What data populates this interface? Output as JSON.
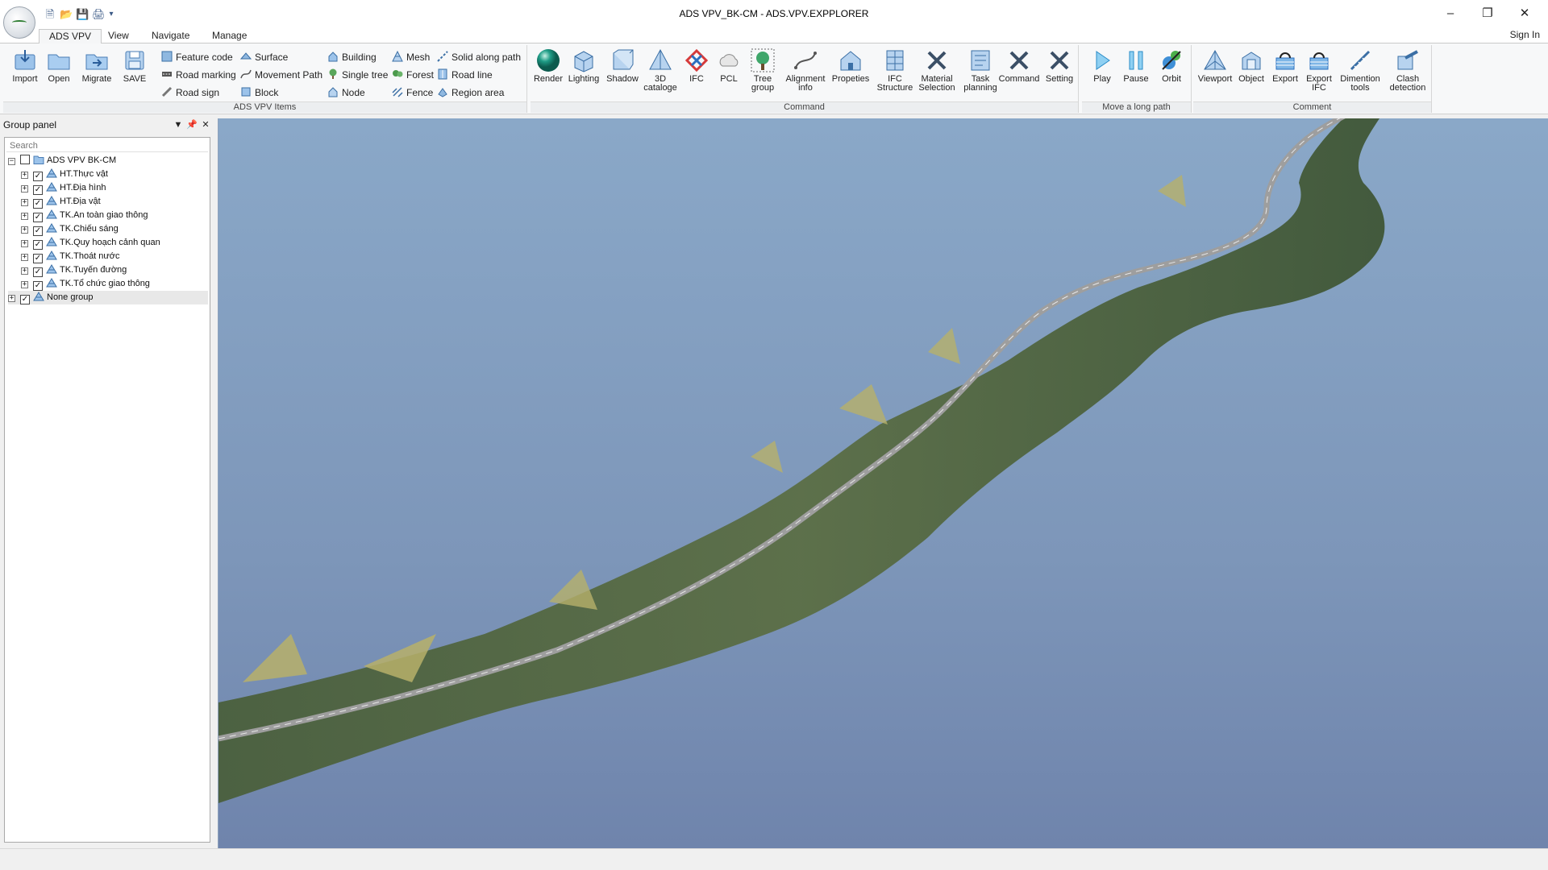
{
  "window": {
    "title": "ADS VPV_BK-CM - ADS.VPV.EXPPLORER",
    "minimize": "–",
    "restore": "❐",
    "close": "✕"
  },
  "quick_access": {
    "dropdown": "▾"
  },
  "tabs": [
    {
      "label": "ADS VPV"
    },
    {
      "label": "View"
    },
    {
      "label": "Navigate"
    },
    {
      "label": "Manage"
    }
  ],
  "sign_in": "Sign In",
  "ribbon": {
    "file_buttons": [
      {
        "label": "Import",
        "icon": "import-icon"
      },
      {
        "label": "Open",
        "icon": "folder-icon"
      },
      {
        "label": "Migrate",
        "icon": "migrate-icon"
      },
      {
        "label": "SAVE",
        "icon": "save-icon"
      }
    ],
    "ads_items": {
      "label": "ADS VPV Items",
      "items": [
        {
          "label": "Feature code",
          "icon": "feature-code-icon"
        },
        {
          "label": "Road marking",
          "icon": "road-marking-icon"
        },
        {
          "label": "Road sign",
          "icon": "road-sign-icon"
        },
        {
          "label": "Surface",
          "icon": "surface-icon"
        },
        {
          "label": "Movement Path",
          "icon": "movement-path-icon"
        },
        {
          "label": "Block",
          "icon": "block-icon"
        },
        {
          "label": "Building",
          "icon": "building-icon"
        },
        {
          "label": "Single tree",
          "icon": "single-tree-icon"
        },
        {
          "label": "Node",
          "icon": "node-icon"
        },
        {
          "label": "Mesh",
          "icon": "mesh-icon"
        },
        {
          "label": "Forest",
          "icon": "forest-icon"
        },
        {
          "label": "Fence",
          "icon": "fence-icon"
        },
        {
          "label": "Solid along path",
          "icon": "solid-along-path-icon"
        },
        {
          "label": "Road line",
          "icon": "road-line-icon"
        },
        {
          "label": "Region area",
          "icon": "region-area-icon"
        }
      ]
    },
    "command": {
      "label": "Command",
      "buttons": [
        {
          "line1": "Render",
          "line2": "",
          "icon": "render-sphere-icon"
        },
        {
          "line1": "Lighting",
          "line2": "",
          "icon": "lighting-icon"
        },
        {
          "line1": "Shadow",
          "line2": "",
          "icon": "shadow-icon"
        },
        {
          "line1": "3D",
          "line2": "cataloge",
          "icon": "catalogue-icon"
        },
        {
          "line1": "IFC",
          "line2": "",
          "icon": "ifc-icon"
        },
        {
          "line1": "PCL",
          "line2": "",
          "icon": "point-cloud-icon"
        },
        {
          "line1": "Tree",
          "line2": "group",
          "icon": "tree-group-icon"
        },
        {
          "line1": "Alignment",
          "line2": "info",
          "icon": "alignment-icon"
        },
        {
          "line1": "Propeties",
          "line2": "",
          "icon": "properties-house-icon"
        },
        {
          "line1": "IFC",
          "line2": "Structure",
          "icon": "ifc-structure-icon"
        },
        {
          "line1": "Material",
          "line2": "Selection",
          "icon": "material-tools-icon"
        },
        {
          "line1": "Task",
          "line2": "planning",
          "icon": "task-planning-icon"
        },
        {
          "line1": "Command",
          "line2": "",
          "icon": "command-tools-icon"
        },
        {
          "line1": "Setting",
          "line2": "",
          "icon": "setting-tools-icon"
        }
      ]
    },
    "move": {
      "label": "Move a long path",
      "buttons": [
        {
          "line1": "Play",
          "icon": "play-icon"
        },
        {
          "line1": "Pause",
          "icon": "pause-icon"
        },
        {
          "line1": "Orbit",
          "icon": "orbit-icon"
        }
      ]
    },
    "comment": {
      "label": "Comment",
      "buttons": [
        {
          "line1": "Viewport",
          "line2": "",
          "icon": "viewport-icon"
        },
        {
          "line1": "Object",
          "line2": "",
          "icon": "object-icon"
        },
        {
          "line1": "Export",
          "line2": "",
          "icon": "export-icon"
        },
        {
          "line1": "Export",
          "line2": "IFC",
          "icon": "export-ifc-icon"
        },
        {
          "line1": "Dimention",
          "line2": "tools",
          "icon": "dimension-tools-icon"
        },
        {
          "line1": "Clash",
          "line2": "detection",
          "icon": "clash-detection-icon"
        }
      ]
    }
  },
  "group_panel": {
    "title": "Group panel",
    "search_placeholder": "Search",
    "root": {
      "label": "ADS VPV BK-CM",
      "checked": false
    },
    "children": [
      {
        "label": "HT.Thực vật",
        "checked": true
      },
      {
        "label": "HT.Địa hình",
        "checked": true
      },
      {
        "label": "HT.Địa vật",
        "checked": true
      },
      {
        "label": "TK.An toàn giao thông",
        "checked": true
      },
      {
        "label": "TK.Chiếu sáng",
        "checked": true
      },
      {
        "label": "TK.Quy hoạch cảnh quan",
        "checked": true
      },
      {
        "label": "TK.Thoát nước",
        "checked": true
      },
      {
        "label": "TK.Tuyến đường",
        "checked": true
      },
      {
        "label": "TK.Tổ chức giao thông",
        "checked": true
      }
    ],
    "none_group": {
      "label": "None group",
      "checked": true
    }
  },
  "colors": {
    "accent": "#3a78c2",
    "terrain_dark": "#3f5a3a",
    "terrain_light": "#7b8a5c",
    "slope_fill": "#b7b06a",
    "sky_top": "#8aa8c8",
    "sky_bottom": "#6f84ac"
  }
}
